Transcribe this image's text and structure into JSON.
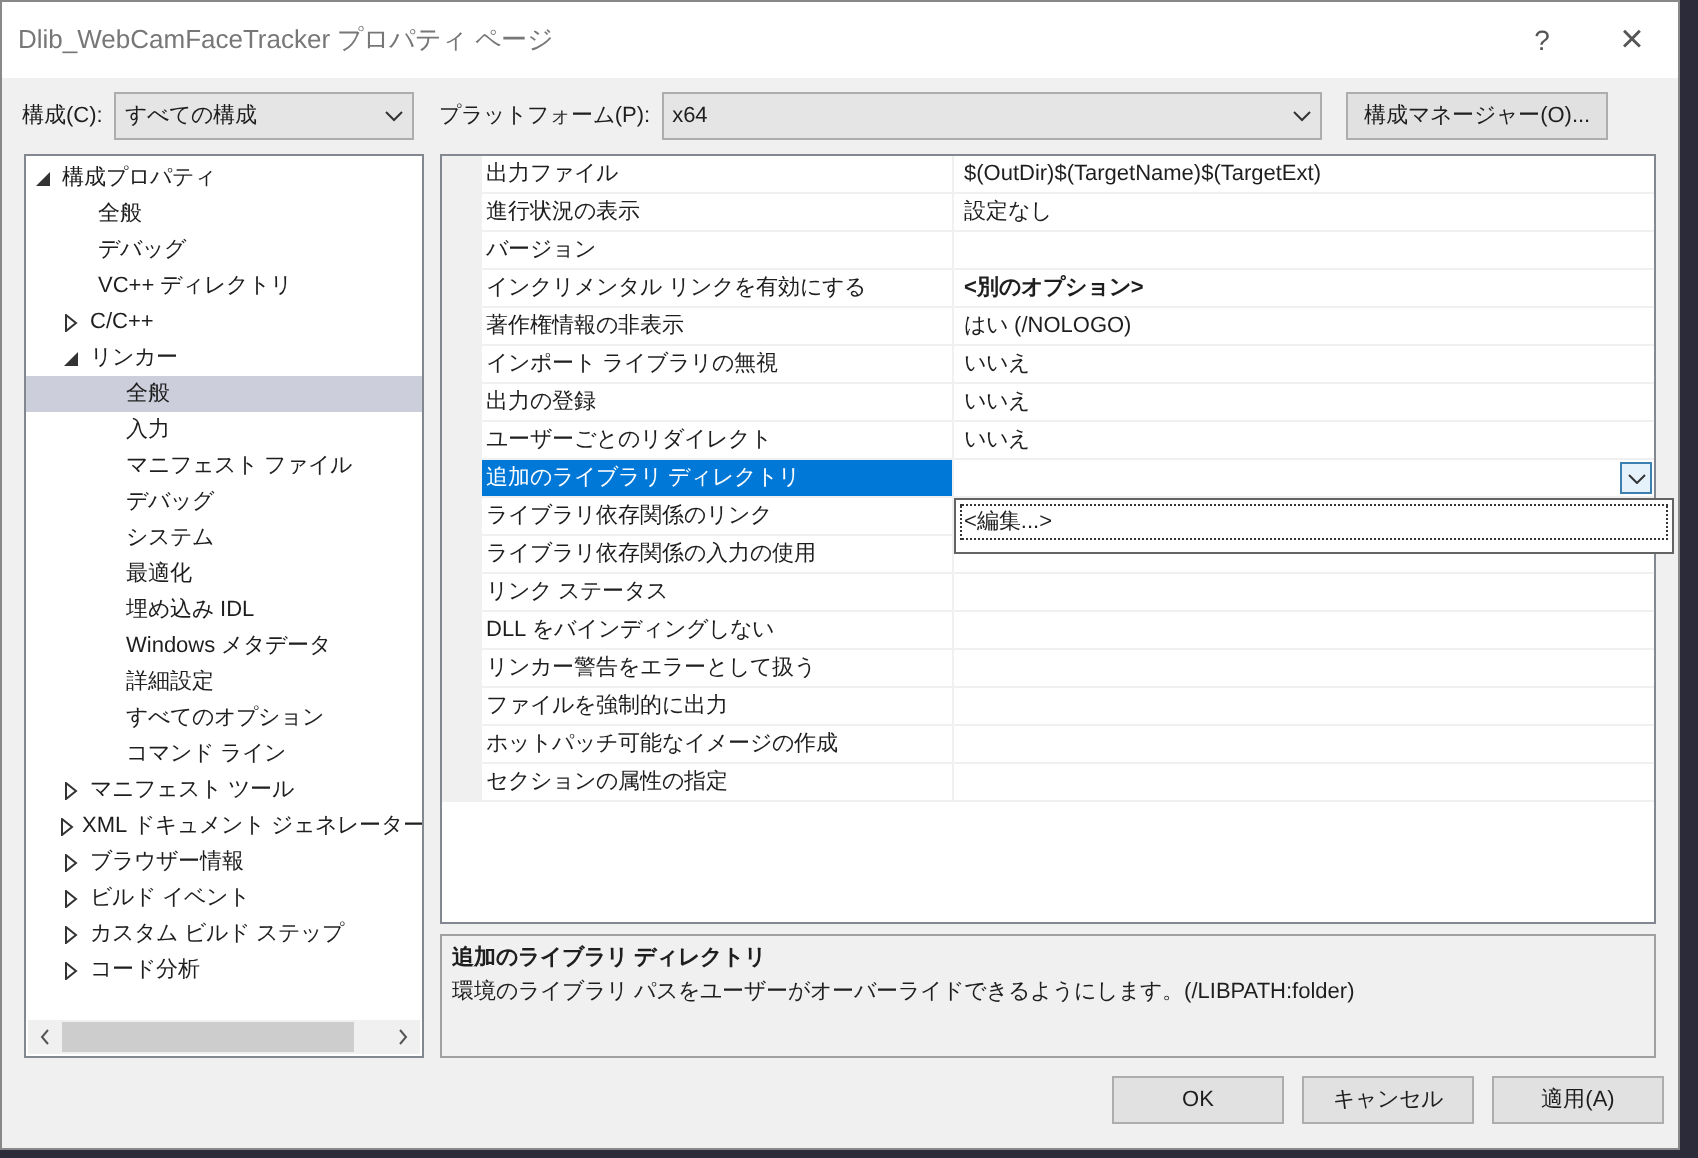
{
  "window": {
    "title": "Dlib_WebCamFaceTracker プロパティ ページ",
    "help": "?",
    "close": "×"
  },
  "toolbar": {
    "config_label": "構成(C):",
    "config_value": "すべての構成",
    "platform_label": "プラットフォーム(P):",
    "platform_value": "x64",
    "manager_button": "構成マネージャー(O)..."
  },
  "tree": [
    {
      "label": "構成プロパティ",
      "kind": "node",
      "expanded": true,
      "selected": false,
      "children": [
        {
          "label": "全般",
          "kind": "leaf",
          "selected": false
        },
        {
          "label": "デバッグ",
          "kind": "leaf",
          "selected": false
        },
        {
          "label": "VC++ ディレクトリ",
          "kind": "leaf",
          "selected": false
        },
        {
          "label": "C/C++",
          "kind": "node",
          "expanded": false,
          "selected": false
        },
        {
          "label": "リンカー",
          "kind": "node",
          "expanded": true,
          "selected": false,
          "children": [
            {
              "label": "全般",
              "kind": "leaf",
              "selected": true
            },
            {
              "label": "入力",
              "kind": "leaf",
              "selected": false
            },
            {
              "label": "マニフェスト ファイル",
              "kind": "leaf",
              "selected": false
            },
            {
              "label": "デバッグ",
              "kind": "leaf",
              "selected": false
            },
            {
              "label": "システム",
              "kind": "leaf",
              "selected": false
            },
            {
              "label": "最適化",
              "kind": "leaf",
              "selected": false
            },
            {
              "label": "埋め込み IDL",
              "kind": "leaf",
              "selected": false
            },
            {
              "label": "Windows メタデータ",
              "kind": "leaf",
              "selected": false
            },
            {
              "label": "詳細設定",
              "kind": "leaf",
              "selected": false
            },
            {
              "label": "すべてのオプション",
              "kind": "leaf",
              "selected": false
            },
            {
              "label": "コマンド ライン",
              "kind": "leaf",
              "selected": false
            }
          ]
        },
        {
          "label": "マニフェスト ツール",
          "kind": "node",
          "expanded": false,
          "selected": false
        },
        {
          "label": "XML ドキュメント ジェネレーター",
          "kind": "node",
          "expanded": false,
          "selected": false
        },
        {
          "label": "ブラウザー情報",
          "kind": "node",
          "expanded": false,
          "selected": false
        },
        {
          "label": "ビルド イベント",
          "kind": "node",
          "expanded": false,
          "selected": false
        },
        {
          "label": "カスタム ビルド ステップ",
          "kind": "node",
          "expanded": false,
          "selected": false
        },
        {
          "label": "コード分析",
          "kind": "node",
          "expanded": false,
          "selected": false
        }
      ]
    }
  ],
  "grid": {
    "rows": [
      {
        "name": "出力ファイル",
        "value": "$(OutDir)$(TargetName)$(TargetExt)",
        "bold": false,
        "selected": false
      },
      {
        "name": "進行状況の表示",
        "value": "設定なし",
        "bold": false,
        "selected": false
      },
      {
        "name": "バージョン",
        "selected": false
      },
      {
        "name": "インクリメンタル リンクを有効にする",
        "value": "<別のオプション>",
        "bold": true,
        "selected": false
      },
      {
        "name": "著作権情報の非表示",
        "value": "はい (/NOLOGO)",
        "bold": false,
        "selected": false
      },
      {
        "name": "インポート ライブラリの無視",
        "value": "いいえ",
        "bold": false,
        "selected": false
      },
      {
        "name": "出力の登録",
        "value": "いいえ",
        "bold": false,
        "selected": false
      },
      {
        "name": "ユーザーごとのリダイレクト",
        "value": "いいえ",
        "bold": false,
        "selected": false
      },
      {
        "name": "追加のライブラリ ディレクトリ",
        "selected": true
      },
      {
        "name": "ライブラリ依存関係のリンク",
        "selected": false
      },
      {
        "name": "ライブラリ依存関係の入力の使用",
        "selected": false
      },
      {
        "name": "リンク ステータス",
        "selected": false
      },
      {
        "name": "DLL をバインディングしない",
        "selected": false
      },
      {
        "name": "リンカー警告をエラーとして扱う",
        "selected": false
      },
      {
        "name": "ファイルを強制的に出力",
        "selected": false
      },
      {
        "name": "ホットパッチ可能なイメージの作成",
        "selected": false
      },
      {
        "name": "セクションの属性の指定",
        "selected": false
      }
    ],
    "dropdown": {
      "options": [
        "<編集...>"
      ]
    }
  },
  "description": {
    "title": "追加のライブラリ ディレクトリ",
    "text": "環境のライブラリ パスをユーザーがオーバーライドできるようにします。(/LIBPATH:folder)"
  },
  "buttons": [
    "OK",
    "キャンセル",
    "適用(A)"
  ]
}
